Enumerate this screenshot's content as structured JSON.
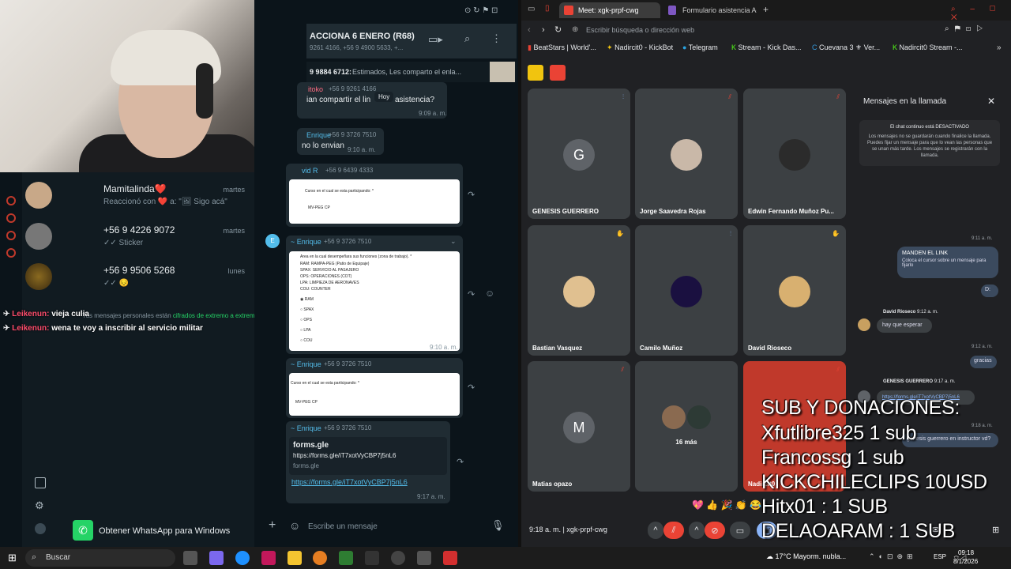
{
  "webcam": {},
  "whatsapp_list": {
    "chats": [
      {
        "name": "Mamitalinda❤️",
        "time": "martes",
        "preview": "Reaccionó con ❤️ a: \"🖼 Sigo acá\""
      },
      {
        "name": "+56 9 4226 9072",
        "time": "martes",
        "preview": "✓✓ Sticker"
      },
      {
        "name": "+56 9 9506 5268",
        "time": "lunes",
        "preview": "✓✓ 😔"
      }
    ],
    "encryption_note": "Tus mensajes personales están",
    "encryption_link": "cifrados de extremo a extremo",
    "get_app": "Obtener WhatsApp para Windows"
  },
  "stream_chat": [
    {
      "user": "Leikenun:",
      "message": "vieja culia"
    },
    {
      "user": "Leikenun:",
      "message": "wena te voy a inscribir al servicio militar"
    }
  ],
  "whatsapp_chat": {
    "title": "ACCIONA 6 ENERO (R68)",
    "participants": "9261 4166, +56 9 4900 5633, +...",
    "pinned_number": "9 9884 6712:",
    "pinned_text": "Estimados, Les comparto el enla...",
    "msg1_sender": "itoko",
    "msg1_phone": "+56 9 9261 4166",
    "msg1_text_a": "ian compartir el lin",
    "msg1_today": "Hoy",
    "msg1_text_b": "asistencia?",
    "msg1_time": "9:09 a. m.",
    "msg2_sender": "Enrique",
    "msg2_phone": "+56 9 3726 7510",
    "msg2_text": "no lo envian",
    "msg2_time": "9:10 a. m.",
    "msg3_sender": "vid R",
    "msg3_phone": "+56 9 6439 4333",
    "form_q1": "Curso en el cual se esta participando: *",
    "form_sel1": "MV-PEG CP",
    "msg3_time": "9:10 a. m.",
    "msg4_sender": "~ Enrique",
    "msg4_phone": "+56 9 3726 7510",
    "form_q2": "Area en la cual desempeñara sus funciones (zona de trabajo). *",
    "form_q2_lines": [
      "RAM: RAMPA-PEG (Patio de Equipaje)",
      "SPAX: SERVICIO AL PASAJERO",
      "OPS: OPERACIONES (COT)",
      "LPA: LIMPIEZA DE AERONAVES",
      "COU: COUNTER"
    ],
    "form_q2_options": [
      "RAM",
      "SPAX",
      "OPS",
      "LPA",
      "COU"
    ],
    "msg4_time": "9:10 a. m.",
    "msg5_sender": "~ Enrique",
    "msg5_phone": "+56 9 3726 7510",
    "form_q3": "Curso en el cual se esta participando: *",
    "form_sel3": "MV-PEG CP",
    "msg5_time": "9:10 a. m.",
    "msg6_sender": "~ Enrique",
    "msg6_phone": "+56 9 3726 7510",
    "link_title": "forms.gle",
    "link_url": "https://forms.gle/iT7xotVyCBP7j5nL6",
    "link_domain": "forms.gle",
    "link_full": "https://forms.gle/iT7xotVyCBP7j5nL6",
    "msg6_time": "9:17 a. m.",
    "composer_placeholder": "Escribe un mensaje"
  },
  "browser": {
    "tabs": [
      "Meet: xgk-prpf-cwg",
      "Formulario asistencia Acc"
    ],
    "address_placeholder": "Escribir búsqueda o dirección web",
    "bookmarks": [
      "BeatStars | World'...",
      "Nadircit0 - KickBot",
      "Telegram",
      "Stream - Kick Das...",
      "Cuevana 3 ⚜ Ver...",
      "Nadircit0 Stream -..."
    ]
  },
  "meet": {
    "participants": [
      {
        "name": "GENESIS GUERRERO",
        "initial": "G",
        "color": "#5f6368"
      },
      {
        "name": "Jorge Saavedra Rojas",
        "initial": "",
        "color": "#c9b8a8"
      },
      {
        "name": "Edwin Fernando Muñoz Pu...",
        "initial": "",
        "color": "#2b2b2b"
      },
      {
        "name": "Bastian Vasquez",
        "initial": "",
        "color": "#e0c090"
      },
      {
        "name": "Camilo Muñoz",
        "initial": "",
        "color": "#1a1040"
      },
      {
        "name": "David Rioseco",
        "initial": "",
        "color": "#d8b070"
      },
      {
        "name": "Matias opazo",
        "initial": "M",
        "color": "#5f6368"
      },
      {
        "name": "16 más",
        "initial": "",
        "color": "#3c4043"
      },
      {
        "name": "Nadircit0",
        "initial": "",
        "color": "#c0392b"
      }
    ],
    "chat_title": "Mensajes en la llamada",
    "chat_notice_title": "El chat continuo está DESACTIVADO",
    "chat_notice_body": "Los mensajes no se guardarán cuando finalice la llamada. Puedes fijar un mensaje para que lo vean las personas que se unan más tarde. Los mensajes se registrarán con la llamada.",
    "time1": "9:11 a. m.",
    "pinned_title": "MANDEN EL LINK",
    "pinned_sub": "Coloca el cursor sobre un mensaje para fijarlo",
    "reply1": "D:",
    "david_name": "David Rioseco",
    "david_time": "9:12 a. m.",
    "david_msg": "hay que esperar",
    "time2": "9:12 a. m.",
    "reply2": "gracias",
    "genesis_name": "GENESIS GUERRERO",
    "genesis_time": "9:17 a. m.",
    "genesis_link": "https://forms.gle/iT7xotVyCBP7j5nL6",
    "time3": "9:18 a. m.",
    "reply3": "genesis guerrero en instructor vd?",
    "meeting_time": "9:18 a. m.",
    "meeting_code": "xgk-prpf-cwg"
  },
  "stream_overlay": {
    "lines": [
      "SUB Y DONACIONES:",
      "Xfutlibre325 1 sub",
      "Francossg 1 sub",
      "KICKCHILECLIPS 10USD",
      "Hitx01 : 1 SUB",
      "DELAOARAM : 1 SUB"
    ]
  },
  "taskbar": {
    "search": "Buscar",
    "weather": "17°C  Mayorm. nubla...",
    "lang": "ESP",
    "clock_time": "09:18",
    "clock_date": "8/1/2026"
  }
}
